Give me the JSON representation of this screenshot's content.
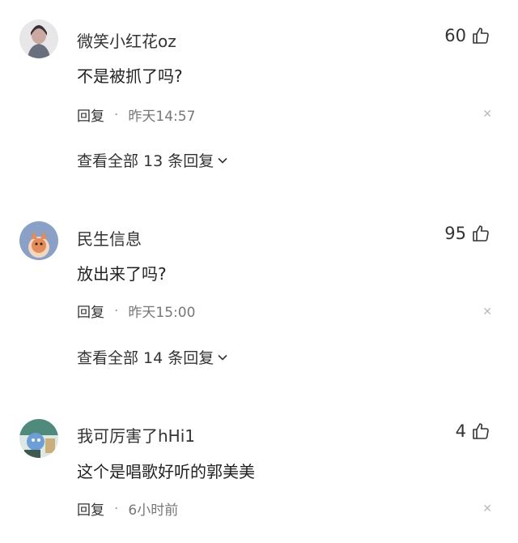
{
  "comments": [
    {
      "username": "微笑小红花oz",
      "likes": "60",
      "text": "不是被抓了吗?",
      "reply_label": "回复",
      "dot": "·",
      "time": "昨天14:57",
      "more_replies": "查看全部 13 条回复"
    },
    {
      "username": "民生信息",
      "likes": "95",
      "text": "放出来了吗?",
      "reply_label": "回复",
      "dot": "·",
      "time": "昨天15:00",
      "more_replies": "查看全部 14 条回复"
    },
    {
      "username": "我可厉害了hHi1",
      "likes": "4",
      "text": "这个是唱歌好听的郭美美",
      "reply_label": "回复",
      "dot": "·",
      "time": "6小时前"
    }
  ],
  "icons": {
    "like": "thumbs-up-icon",
    "close": "close-icon",
    "expand": "chevron-down-icon"
  },
  "colors": {
    "avatar1": "#6a6f7d",
    "avatar2": "#8aa0c7",
    "avatar3": "#4f8a7c"
  }
}
